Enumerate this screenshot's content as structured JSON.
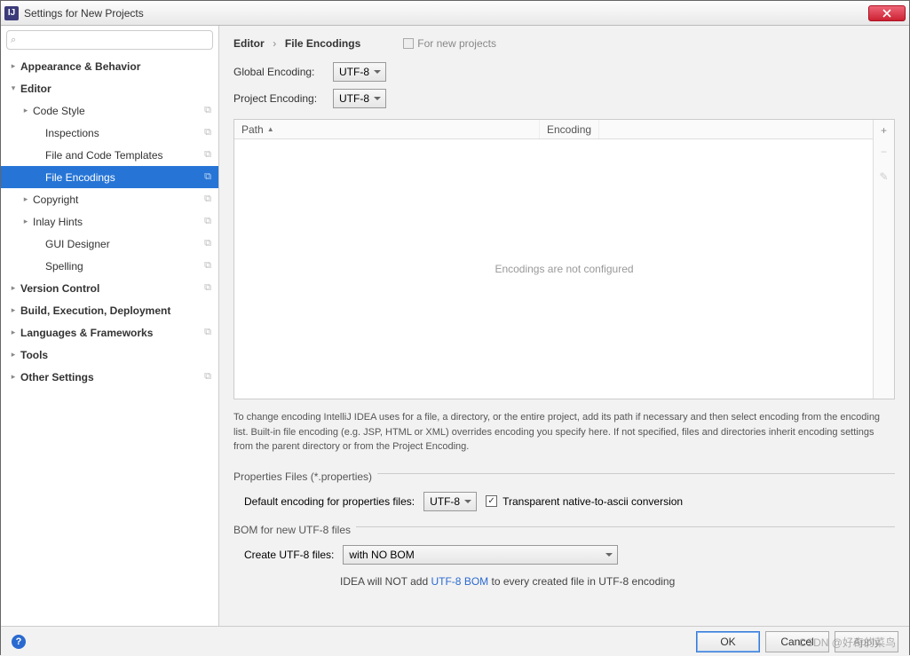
{
  "window": {
    "title": "Settings for New Projects"
  },
  "sidebar": {
    "search_placeholder": "",
    "items": [
      {
        "label": "Appearance & Behavior",
        "level": 0,
        "bold": true,
        "expandable": true,
        "expanded": false,
        "copy": false
      },
      {
        "label": "Editor",
        "level": 0,
        "bold": true,
        "expandable": true,
        "expanded": true,
        "copy": false
      },
      {
        "label": "Code Style",
        "level": 1,
        "bold": false,
        "expandable": true,
        "expanded": false,
        "copy": true
      },
      {
        "label": "Inspections",
        "level": 2,
        "bold": false,
        "expandable": false,
        "expanded": false,
        "copy": true
      },
      {
        "label": "File and Code Templates",
        "level": 2,
        "bold": false,
        "expandable": false,
        "expanded": false,
        "copy": true
      },
      {
        "label": "File Encodings",
        "level": 2,
        "bold": false,
        "expandable": false,
        "expanded": false,
        "copy": true,
        "selected": true
      },
      {
        "label": "Copyright",
        "level": 1,
        "bold": false,
        "expandable": true,
        "expanded": false,
        "copy": true
      },
      {
        "label": "Inlay Hints",
        "level": 1,
        "bold": false,
        "expandable": true,
        "expanded": false,
        "copy": true
      },
      {
        "label": "GUI Designer",
        "level": 2,
        "bold": false,
        "expandable": false,
        "expanded": false,
        "copy": true
      },
      {
        "label": "Spelling",
        "level": 2,
        "bold": false,
        "expandable": false,
        "expanded": false,
        "copy": true
      },
      {
        "label": "Version Control",
        "level": 0,
        "bold": true,
        "expandable": true,
        "expanded": false,
        "copy": true
      },
      {
        "label": "Build, Execution, Deployment",
        "level": 0,
        "bold": true,
        "expandable": true,
        "expanded": false,
        "copy": false
      },
      {
        "label": "Languages & Frameworks",
        "level": 0,
        "bold": true,
        "expandable": true,
        "expanded": false,
        "copy": true
      },
      {
        "label": "Tools",
        "level": 0,
        "bold": true,
        "expandable": true,
        "expanded": false,
        "copy": false
      },
      {
        "label": "Other Settings",
        "level": 0,
        "bold": true,
        "expandable": true,
        "expanded": false,
        "copy": true
      }
    ]
  },
  "breadcrumb": {
    "part1": "Editor",
    "part2": "File Encodings",
    "for_new": "For new projects"
  },
  "encoding": {
    "global_label": "Global Encoding:",
    "global_value": "UTF-8",
    "project_label": "Project Encoding:",
    "project_value": "UTF-8"
  },
  "table": {
    "col_path": "Path",
    "col_encoding": "Encoding",
    "empty_text": "Encodings are not configured"
  },
  "help_text": "To change encoding IntelliJ IDEA uses for a file, a directory, or the entire project, add its path if necessary and then select encoding from the encoding list. Built-in file encoding (e.g. JSP, HTML or XML) overrides encoding you specify here. If not specified, files and directories inherit encoding settings from the parent directory or from the Project Encoding.",
  "properties": {
    "group_label": "Properties Files (*.properties)",
    "default_label": "Default encoding for properties files:",
    "default_value": "UTF-8",
    "transparent_label": "Transparent native-to-ascii conversion"
  },
  "bom": {
    "group_label": "BOM for new UTF-8 files",
    "create_label": "Create UTF-8 files:",
    "create_value": "with NO BOM",
    "info_prefix": "IDEA will NOT add ",
    "info_link": "UTF-8 BOM",
    "info_suffix": " to every created file in UTF-8 encoding"
  },
  "footer": {
    "ok": "OK",
    "cancel": "Cancel",
    "apply": "Apply"
  },
  "watermark": "CSDN @好奇的菜鸟"
}
